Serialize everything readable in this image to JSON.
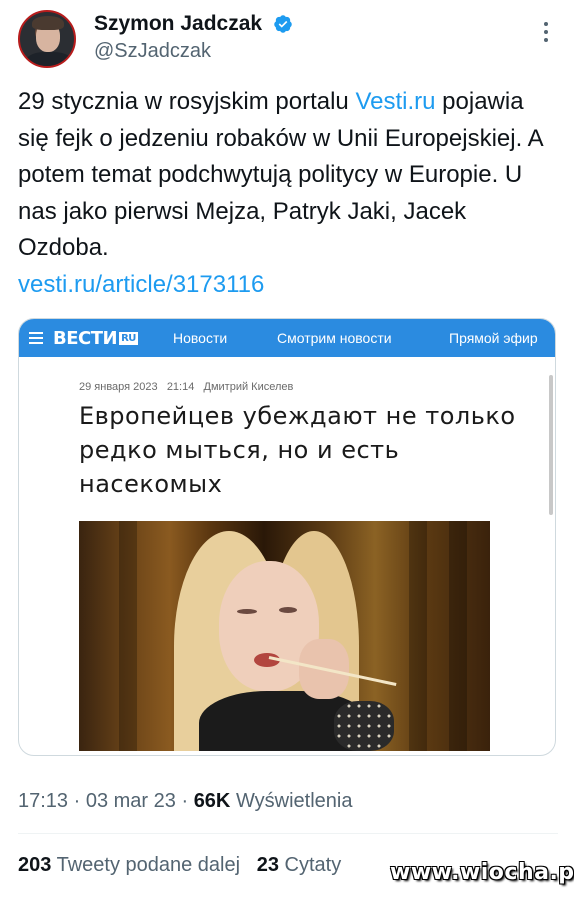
{
  "author": {
    "name": "Szymon Jadczak",
    "handle": "@SzJadczak",
    "verified_icon": "verified-badge-icon"
  },
  "tweet": {
    "text_part1": "29 stycznia w rosyjskim portalu ",
    "link1": "Vesti.ru",
    "text_part2": " pojawia się fejk o jedzeniu robaków w Unii Europejskiej. A potem temat podchwytują politycy w Europie. U nas jako pierwsi Mejza, Patryk Jaki, Jacek Ozdoba.",
    "link2": "vesti.ru/article/3173116"
  },
  "card": {
    "logo": "ВЕСТИ",
    "logo_suffix": "RU",
    "nav": [
      "Новости",
      "Смотрим новости",
      "Прямой эфир"
    ],
    "date": "29 января 2023",
    "time": "21:14",
    "author": "Дмитрий Киселев",
    "headline": "Европейцев убеждают не только редко мыться, но и есть насекомых",
    "accent_color": "#2b8be0"
  },
  "footer": {
    "time": "17:13",
    "sep": " · ",
    "date": "03 mar 23",
    "views_count": "66K",
    "views_label": "Wyświetlenia",
    "retweets_count": "203",
    "retweets_label": "Tweety podane dalej",
    "quotes_count": "23",
    "quotes_label": "Cytaty"
  },
  "watermark": "www.wiocha.pl",
  "colors": {
    "link": "#1d9bf0",
    "text": "#0f1419",
    "muted": "#536471"
  }
}
